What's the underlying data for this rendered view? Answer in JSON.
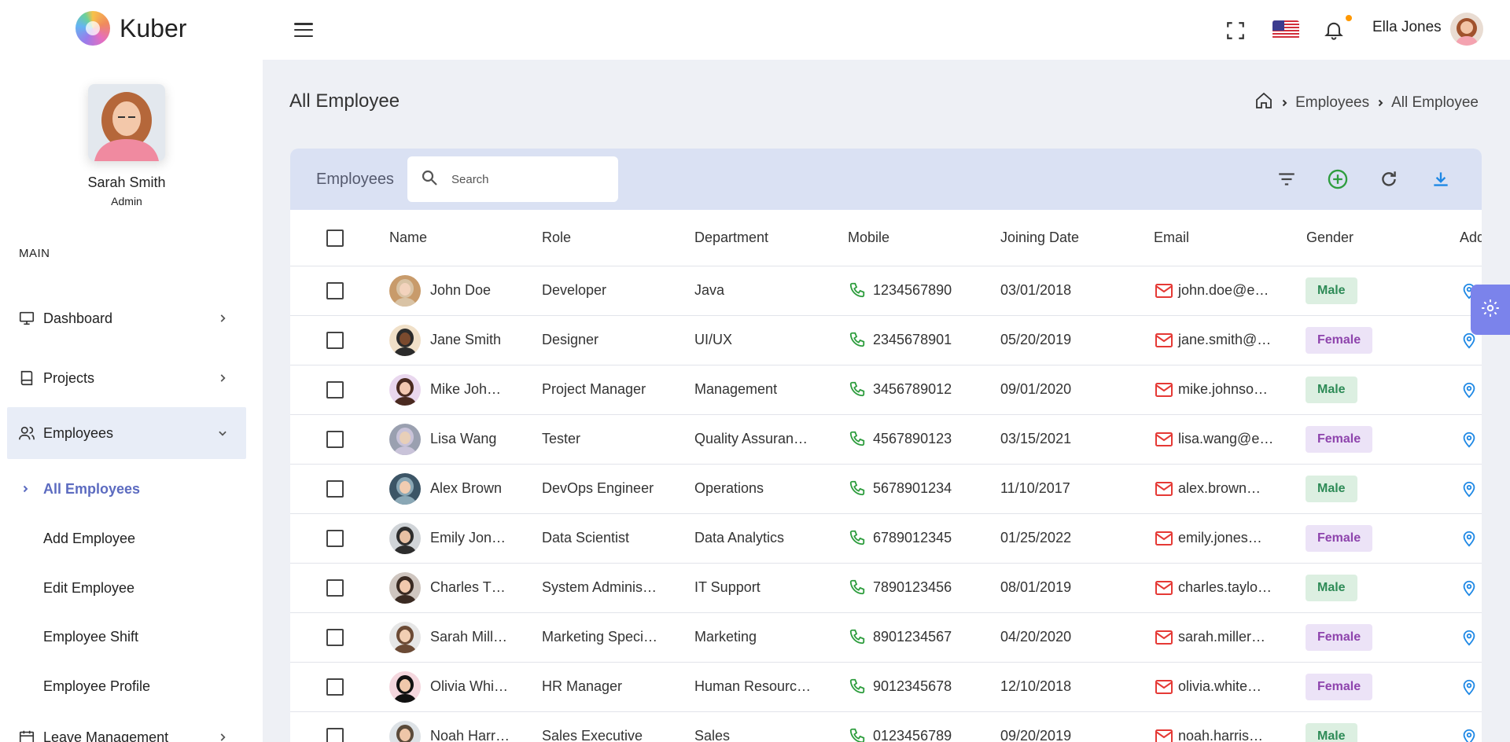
{
  "app": {
    "name": "Kuber"
  },
  "header": {
    "user_name": "Ella Jones"
  },
  "sidebar": {
    "profile": {
      "name": "Sarah Smith",
      "role": "Admin"
    },
    "section_label": "MAIN",
    "items": [
      {
        "label": "Dashboard",
        "icon": "monitor-icon"
      },
      {
        "label": "Projects",
        "icon": "book-icon"
      },
      {
        "label": "Employees",
        "icon": "users-icon"
      },
      {
        "label": "Leave Management",
        "icon": "calendar-icon"
      }
    ],
    "sub_items": [
      "All Employees",
      "Add Employee",
      "Edit Employee",
      "Employee Shift",
      "Employee Profile"
    ]
  },
  "page": {
    "title": "All Employee",
    "breadcrumb": [
      "Employees",
      "All Employee"
    ]
  },
  "card": {
    "title": "Employees",
    "search_placeholder": "Search"
  },
  "table": {
    "columns": [
      "Name",
      "Role",
      "Department",
      "Mobile",
      "Joining Date",
      "Email",
      "Gender",
      "Add"
    ],
    "rows": [
      {
        "name": "John Doe",
        "role": "Developer",
        "department": "Java",
        "mobile": "1234567890",
        "joining": "03/01/2018",
        "email": "john.doe@e…",
        "gender": "Male"
      },
      {
        "name": "Jane Smith",
        "role": "Designer",
        "department": "UI/UX",
        "mobile": "2345678901",
        "joining": "05/20/2019",
        "email": "jane.smith@…",
        "gender": "Female"
      },
      {
        "name": "Mike Joh…",
        "role": "Project Manager",
        "department": "Management",
        "mobile": "3456789012",
        "joining": "09/01/2020",
        "email": "mike.johnso…",
        "gender": "Male"
      },
      {
        "name": "Lisa Wang",
        "role": "Tester",
        "department": "Quality Assuran…",
        "mobile": "4567890123",
        "joining": "03/15/2021",
        "email": "lisa.wang@e…",
        "gender": "Female"
      },
      {
        "name": "Alex Brown",
        "role": "DevOps Engineer",
        "department": "Operations",
        "mobile": "5678901234",
        "joining": "11/10/2017",
        "email": "alex.brown…",
        "gender": "Male"
      },
      {
        "name": "Emily Jon…",
        "role": "Data Scientist",
        "department": "Data Analytics",
        "mobile": "6789012345",
        "joining": "01/25/2022",
        "email": "emily.jones…",
        "gender": "Female"
      },
      {
        "name": "Charles T…",
        "role": "System Adminis…",
        "department": "IT Support",
        "mobile": "7890123456",
        "joining": "08/01/2019",
        "email": "charles.taylo…",
        "gender": "Male"
      },
      {
        "name": "Sarah Mill…",
        "role": "Marketing Speci…",
        "department": "Marketing",
        "mobile": "8901234567",
        "joining": "04/20/2020",
        "email": "sarah.miller…",
        "gender": "Female"
      },
      {
        "name": "Olivia Whi…",
        "role": "HR Manager",
        "department": "Human Resourc…",
        "mobile": "9012345678",
        "joining": "12/10/2018",
        "email": "olivia.white…",
        "gender": "Female"
      },
      {
        "name": "Noah Harr…",
        "role": "Sales Executive",
        "department": "Sales",
        "mobile": "0123456789",
        "joining": "09/20/2019",
        "email": "noah.harris…",
        "gender": "Male"
      }
    ]
  },
  "colors": {
    "accent": "#5c6bc0",
    "header_band": "#dae1f3",
    "phone": "#2e9d3e",
    "mail": "#e53935",
    "pin": "#1e88e5",
    "male_bg": "#dcefe1",
    "female_bg": "#ece3f7"
  }
}
